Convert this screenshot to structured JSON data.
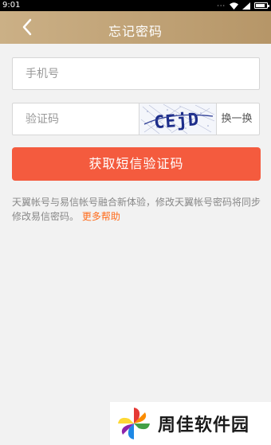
{
  "status_bar": {
    "time": "9:01",
    "signal_dots": "···"
  },
  "nav": {
    "title": "忘记密码"
  },
  "form": {
    "phone_placeholder": "手机号",
    "captcha_placeholder": "验证码",
    "captcha_text": "CEjD",
    "refresh_label": "换一换",
    "submit_label": "获取短信验证码"
  },
  "note": {
    "text": "天翼帐号与易信帐号融合新体验，修改天翼帐号密码将同步修改易信密码。",
    "link": "更多帮助"
  },
  "watermark": {
    "text": "周佳软件园"
  }
}
